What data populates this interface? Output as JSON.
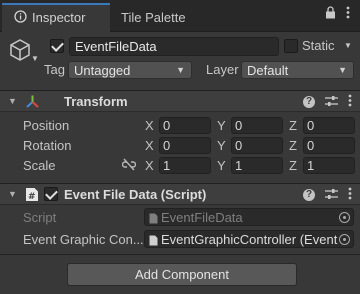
{
  "tabs": {
    "inspector": "Inspector",
    "tile_palette": "Tile Palette"
  },
  "header": {
    "object_name": "EventFileData",
    "active": true,
    "static_label": "Static",
    "static": false,
    "tag_label": "Tag",
    "tag_value": "Untagged",
    "layer_label": "Layer",
    "layer_value": "Default"
  },
  "transform": {
    "title": "Transform",
    "rows": {
      "position": {
        "label": "Position",
        "x": "0",
        "y": "0",
        "z": "0"
      },
      "rotation": {
        "label": "Rotation",
        "x": "0",
        "y": "0",
        "z": "0"
      },
      "scale": {
        "label": "Scale",
        "x": "1",
        "y": "1",
        "z": "1"
      }
    },
    "axis": {
      "x": "X",
      "y": "Y",
      "z": "Z"
    }
  },
  "script_component": {
    "title": "Event File Data (Script)",
    "enabled": true,
    "script_label": "Script",
    "script_value": "EventFileData",
    "field_label": "Event Graphic Con...",
    "field_value": "EventGraphicController (Event"
  },
  "add_component_label": "Add Component",
  "colors": {
    "accent": "#3a79bb",
    "panel": "#383838",
    "tabbar": "#282828"
  }
}
